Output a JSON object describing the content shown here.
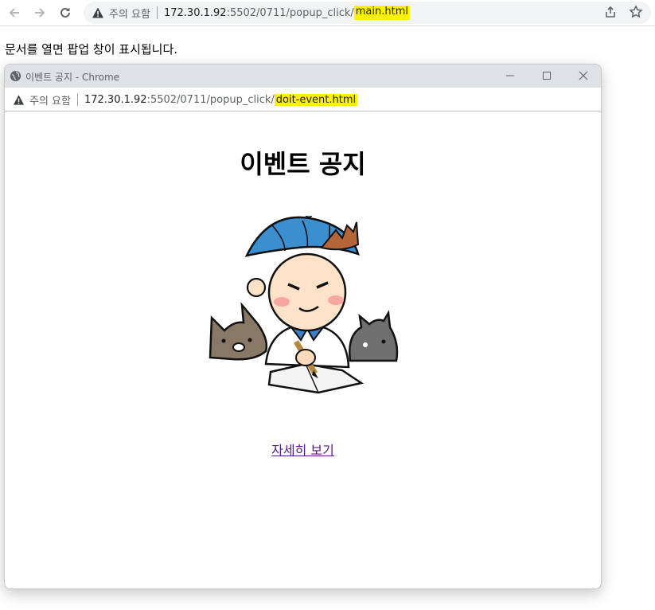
{
  "browser": {
    "security_label": "주의 요함",
    "url_host": "172.30.1.92",
    "url_path": ":5502/0711/popup_click/",
    "url_file": "main.html",
    "highlight_color": "#fff200"
  },
  "page": {
    "message": "문서를 열면 팝업 창이 표시됩니다."
  },
  "popup": {
    "window_title": "이벤트 공지 - Chrome",
    "security_label": "주의 요함",
    "url_host": "172.30.1.92",
    "url_path": ":5502/0711/popup_click/",
    "url_file": "doit-event.html",
    "heading": "이벤트 공지",
    "image_icon": "boy-studying-illustration",
    "link_text": "자세히 보기",
    "link_color": "#551a8b"
  }
}
